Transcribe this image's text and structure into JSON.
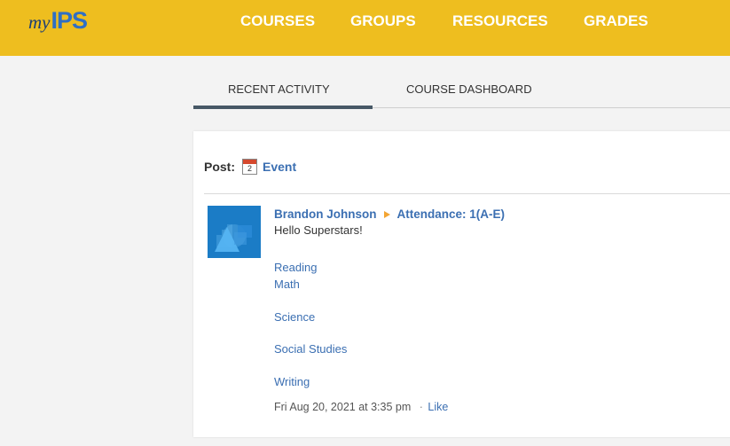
{
  "header": {
    "logo": {
      "prefix": "my",
      "brand": "IPS"
    },
    "nav": [
      "COURSES",
      "GROUPS",
      "RESOURCES",
      "GRADES"
    ]
  },
  "tabs": [
    {
      "label": "RECENT ACTIVITY",
      "active": true
    },
    {
      "label": "COURSE DASHBOARD",
      "active": false
    }
  ],
  "post": {
    "label": "Post:",
    "calendar_day": "2",
    "type_label": "Event"
  },
  "feed": [
    {
      "author": "Brandon Johnson",
      "target": "Attendance: 1(A-E)",
      "message": "Hello Superstars!",
      "subjects": [
        "Reading",
        "Math",
        "Science",
        "Social Studies",
        "Writing"
      ],
      "timestamp": "Fri Aug 20, 2021 at 3:35 pm",
      "separator": "·",
      "like_label": "Like"
    }
  ],
  "colors": {
    "topbar": "#eebe1f",
    "link": "#3b6fb2",
    "avatar": "#1b7cc6",
    "active_tab": "#475866",
    "arrow": "#f3a533"
  }
}
